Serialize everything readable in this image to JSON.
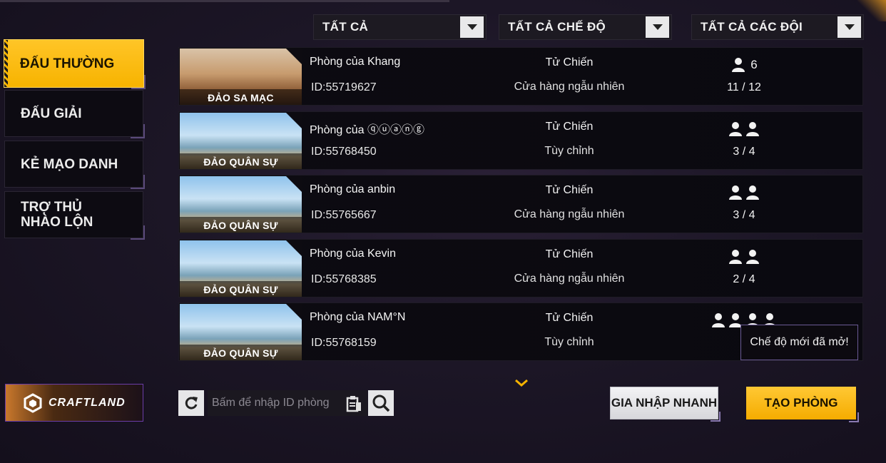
{
  "filters": [
    {
      "label": "TẤT CẢ"
    },
    {
      "label": "TẤT CẢ CHẾ ĐỘ"
    },
    {
      "label": "TẤT CẢ CÁC ĐỘI"
    }
  ],
  "sidebar": {
    "items": [
      {
        "label": "ĐẤU THƯỜNG",
        "active": true
      },
      {
        "label": "ĐẤU GIẢI",
        "active": false
      },
      {
        "label": "KẺ MẠO DANH",
        "active": false
      },
      {
        "label": "TRỢ THỦ NHÀO LỘN",
        "active": false
      }
    ]
  },
  "rooms": [
    {
      "map": "ĐẢO SA MẠC",
      "name": "Phòng của Khang",
      "id": "ID:55719627",
      "mode": "Tử Chiến",
      "shop": "Cửa hàng ngẫu nhiên",
      "team_size": "6",
      "team_icons": 1,
      "players": "11 / 12",
      "theme": "desert"
    },
    {
      "map": "ĐẢO QUÂN SỰ",
      "name": "Phòng của ⓠⓤⓐⓝⓖ",
      "id": "ID:55768450",
      "mode": "Tử Chiến",
      "shop": "Tùy chỉnh",
      "team_size": "",
      "team_icons": 2,
      "players": "3 / 4",
      "theme": "military"
    },
    {
      "map": "ĐẢO QUÂN SỰ",
      "name": "Phòng của anbin",
      "id": "ID:55765667",
      "mode": "Tử Chiến",
      "shop": "Cửa hàng ngẫu nhiên",
      "team_size": "",
      "team_icons": 2,
      "players": "3 / 4",
      "theme": "military"
    },
    {
      "map": "ĐẢO QUÂN SỰ",
      "name": "Phòng của Kevin",
      "id": "ID:55768385",
      "mode": "Tử Chiến",
      "shop": "Cửa hàng ngẫu nhiên",
      "team_size": "",
      "team_icons": 2,
      "players": "2 / 4",
      "theme": "military"
    },
    {
      "map": "ĐẢO QUÂN SỰ",
      "name": "Phòng của NAM°N",
      "id": "ID:55768159",
      "mode": "Tử Chiến",
      "shop": "Tùy chỉnh",
      "team_size": "",
      "team_icons": 4,
      "players": "4",
      "theme": "military"
    }
  ],
  "tooltip": "Chế độ mới đã mở!",
  "craftland": {
    "label": "CRAFTLAND"
  },
  "search": {
    "placeholder": "Bấm để nhập ID phòng"
  },
  "buttons": {
    "quick_join": "GIA NHẬP NHANH",
    "create_room": "TẠO PHÒNG"
  },
  "icons": {
    "refresh": "refresh-icon",
    "paste": "clipboard-icon",
    "search": "search-icon",
    "scroll": "chevron-down-icon",
    "player": "person-icon"
  },
  "colors": {
    "accent": "#f7b300",
    "panel": "#0d0b11",
    "background": "#1c1626"
  }
}
